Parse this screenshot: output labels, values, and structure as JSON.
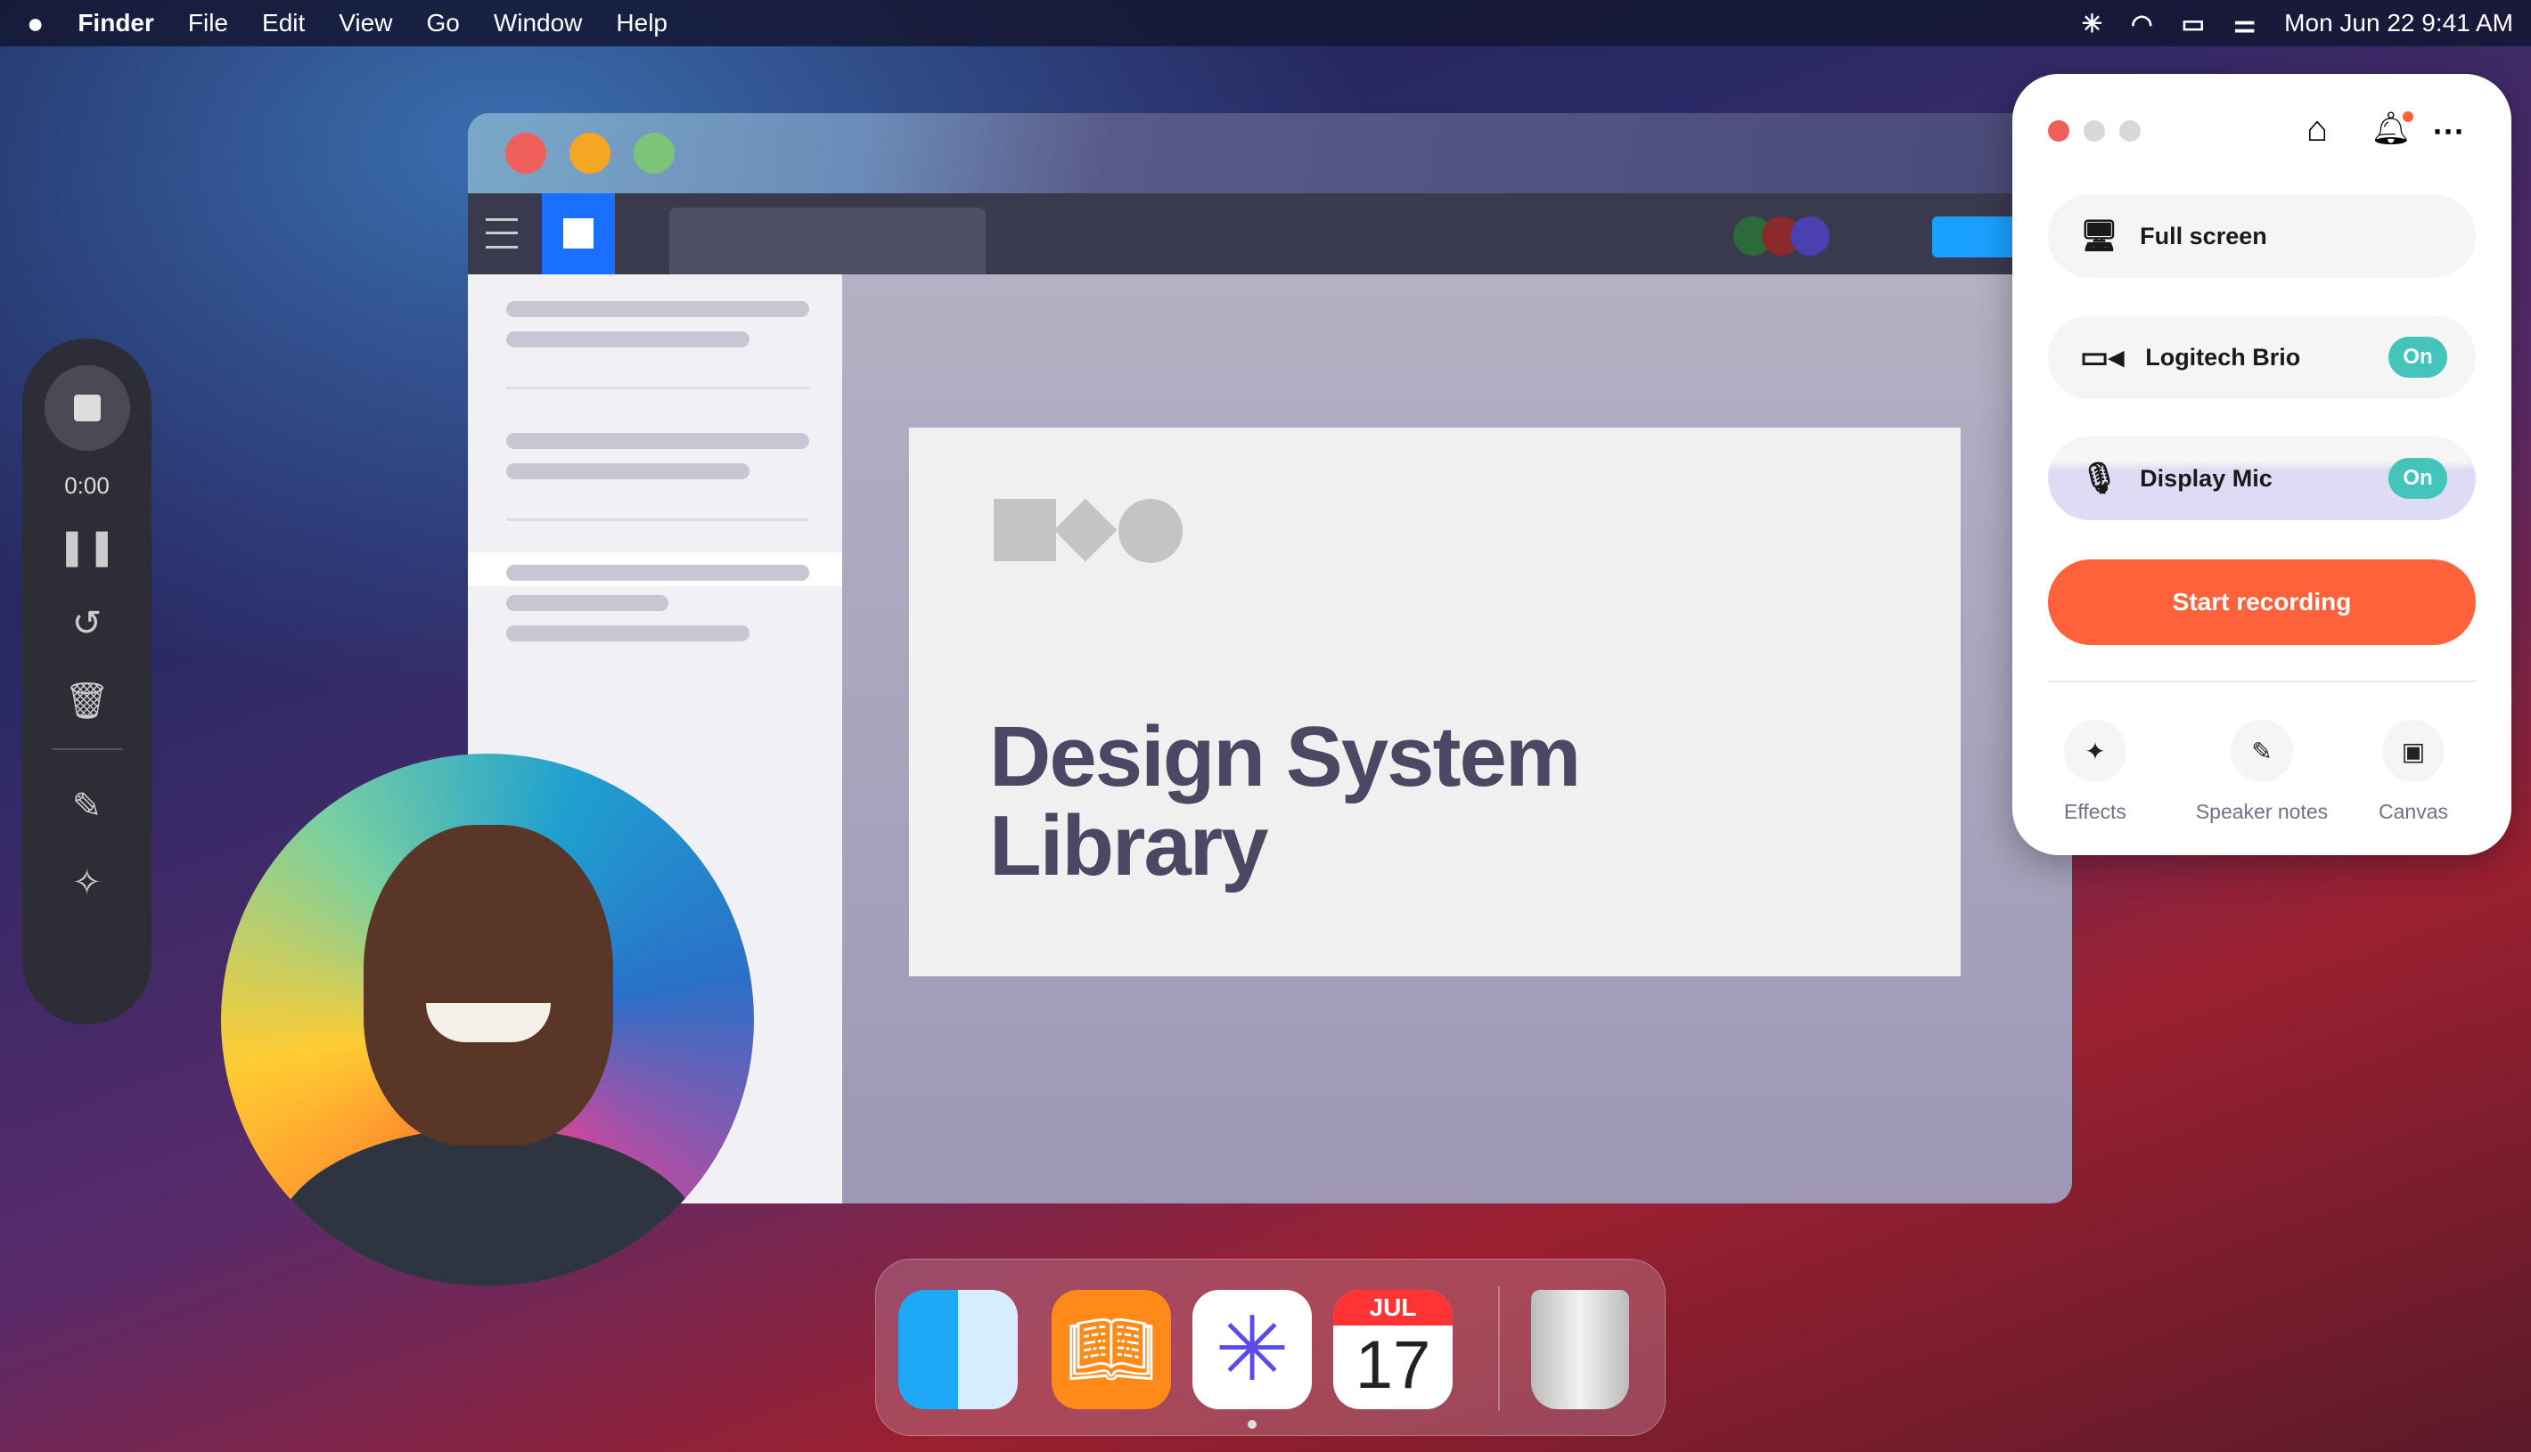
{
  "menubar": {
    "apple": "",
    "app": "Finder",
    "items": [
      "File",
      "Edit",
      "View",
      "Go",
      "Window",
      "Help"
    ],
    "clock": "Mon Jun 22  9:41 AM",
    "status_icons": [
      "brightness-icon",
      "wifi-icon",
      "battery-icon",
      "control-center-icon"
    ]
  },
  "recorder": {
    "timer": "0:00"
  },
  "slide": {
    "title_line1": "Design System",
    "title_line2": "Library"
  },
  "panel": {
    "full_screen": "Full screen",
    "camera": "Logitech Brio",
    "camera_state": "On",
    "mic": "Display Mic",
    "mic_state": "On",
    "start": "Start recording",
    "tools": [
      "Effects",
      "Speaker notes",
      "Canvas"
    ]
  },
  "dock": {
    "calendar_month": "JUL",
    "calendar_day": "17"
  },
  "colors": {
    "accent": "#ff623a",
    "toggle": "#45c4bc"
  }
}
